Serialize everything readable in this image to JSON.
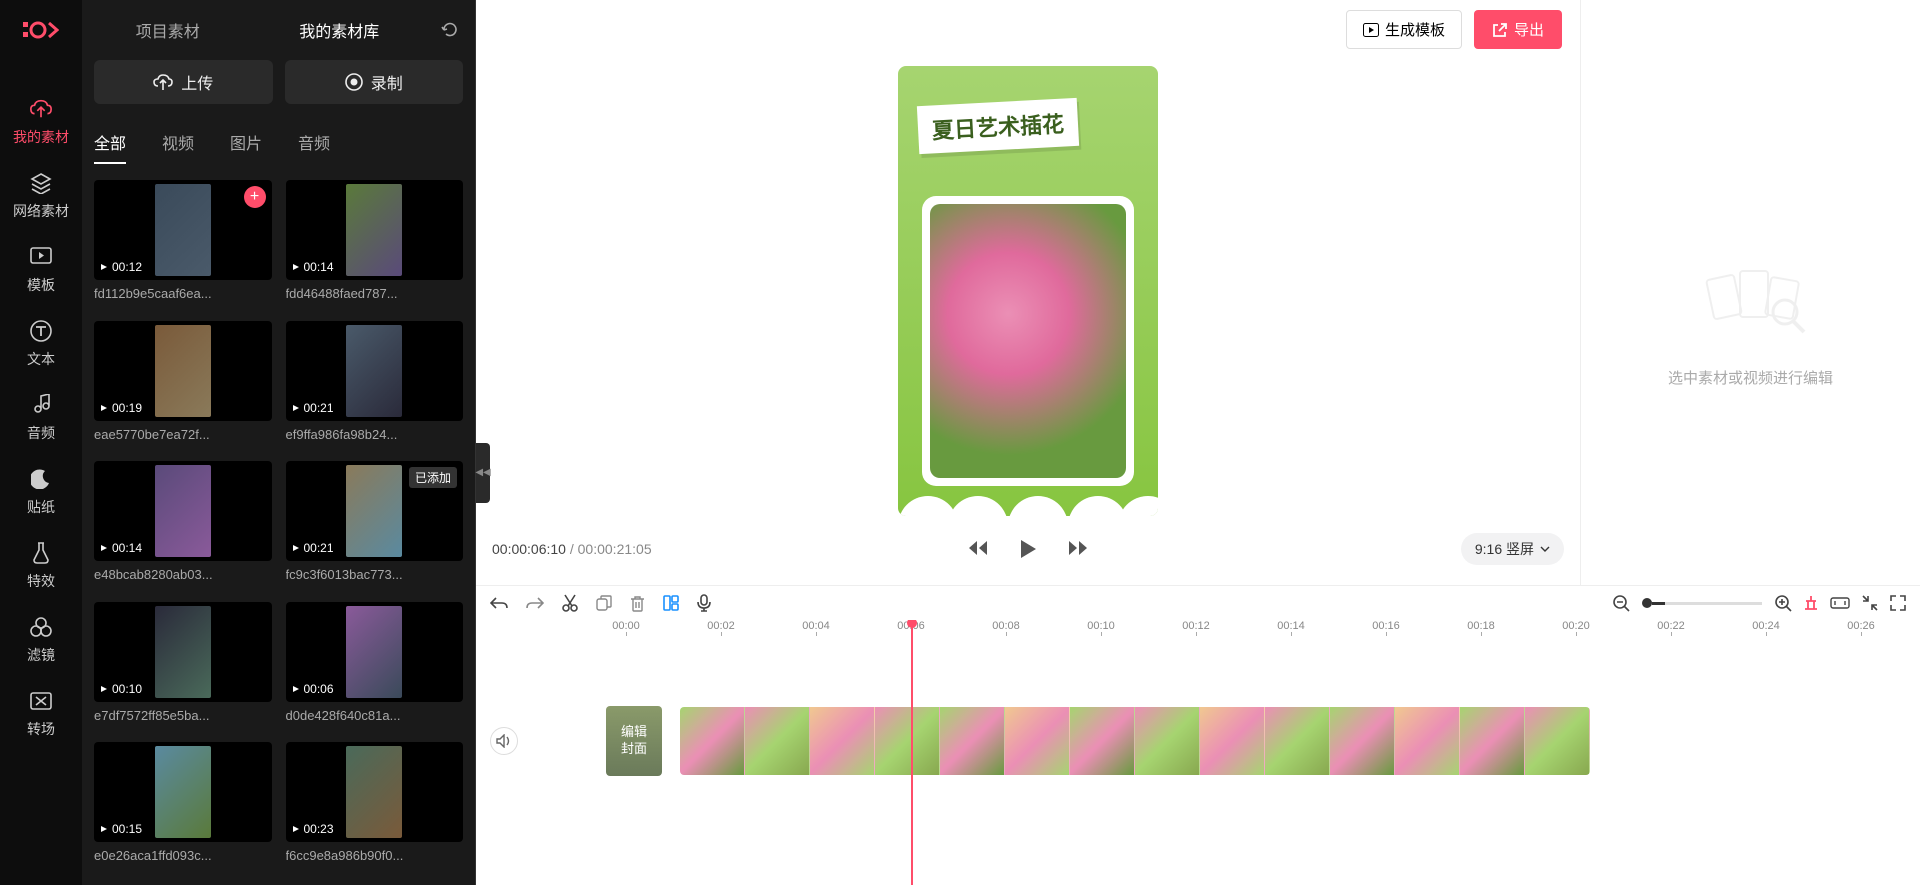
{
  "nav": {
    "items": [
      {
        "label": "我的素材",
        "active": true
      },
      {
        "label": "网络素材",
        "active": false
      },
      {
        "label": "模板",
        "active": false
      },
      {
        "label": "文本",
        "active": false
      },
      {
        "label": "音频",
        "active": false
      },
      {
        "label": "贴纸",
        "active": false
      },
      {
        "label": "特效",
        "active": false
      },
      {
        "label": "滤镜",
        "active": false
      },
      {
        "label": "转场",
        "active": false
      }
    ]
  },
  "asset_panel": {
    "tabs": [
      {
        "label": "项目素材",
        "active": false
      },
      {
        "label": "我的素材库",
        "active": true
      }
    ],
    "actions": {
      "upload": "上传",
      "record": "录制"
    },
    "filters": [
      {
        "label": "全部",
        "active": true
      },
      {
        "label": "视频",
        "active": false
      },
      {
        "label": "图片",
        "active": false
      },
      {
        "label": "音频",
        "active": false
      }
    ],
    "items": [
      {
        "name": "fd112b9e5caaf6ea...",
        "duration": "00:12",
        "showAdd": true
      },
      {
        "name": "fdd46488faed787...",
        "duration": "00:14"
      },
      {
        "name": "eae5770be7ea72f...",
        "duration": "00:19"
      },
      {
        "name": "ef9ffa986fa98b24...",
        "duration": "00:21"
      },
      {
        "name": "e48bcab8280ab03...",
        "duration": "00:14"
      },
      {
        "name": "fc9c3f6013bac773...",
        "duration": "00:21",
        "badge": "已添加"
      },
      {
        "name": "e7df7572ff85e5ba...",
        "duration": "00:10"
      },
      {
        "name": "d0de428f640c81a...",
        "duration": "00:06"
      },
      {
        "name": "e0e26aca1ffd093c...",
        "duration": "00:15"
      },
      {
        "name": "f6cc9e8a986b90f0...",
        "duration": "00:23"
      }
    ]
  },
  "header": {
    "generate_template": "生成模板",
    "export": "导出"
  },
  "preview": {
    "title_card": "夏日艺术插花",
    "current_time": "00:00:06:10",
    "total_time": "00:00:21:05",
    "aspect": "9:16 竖屏"
  },
  "right_panel": {
    "hint": "选中素材或视频进行编辑"
  },
  "timeline": {
    "ruler": [
      "00:00",
      "00:02",
      "00:04",
      "00:06",
      "00:08",
      "00:10",
      "00:12",
      "00:14",
      "00:16",
      "00:18",
      "00:20",
      "00:22",
      "00:24",
      "00:26"
    ],
    "cover_label": "编辑\n封面",
    "frame_count": 14
  }
}
